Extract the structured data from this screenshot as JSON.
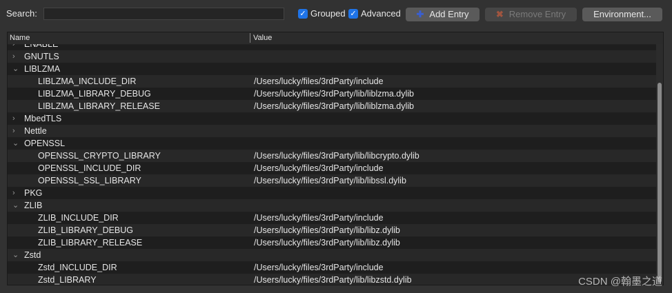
{
  "toolbar": {
    "search_label": "Search:",
    "search_value": "",
    "grouped": "Grouped",
    "advanced": "Advanced",
    "add": "Add Entry",
    "remove": "Remove Entry",
    "environment": "Environment..."
  },
  "table": {
    "headers": [
      "Name",
      "Value"
    ],
    "rows": [
      {
        "name": "ENABLE",
        "value": "",
        "group": true,
        "expanded": false
      },
      {
        "name": "GNUTLS",
        "value": "",
        "group": true,
        "expanded": false
      },
      {
        "name": "LIBLZMA",
        "value": "",
        "group": true,
        "expanded": true
      },
      {
        "name": "LIBLZMA_INCLUDE_DIR",
        "value": "/Users/lucky/files/3rdParty/include"
      },
      {
        "name": "LIBLZMA_LIBRARY_DEBUG",
        "value": "/Users/lucky/files/3rdParty/lib/liblzma.dylib"
      },
      {
        "name": "LIBLZMA_LIBRARY_RELEASE",
        "value": "/Users/lucky/files/3rdParty/lib/liblzma.dylib"
      },
      {
        "name": "MbedTLS",
        "value": "",
        "group": true,
        "expanded": false
      },
      {
        "name": "Nettle",
        "value": "",
        "group": true,
        "expanded": false
      },
      {
        "name": "OPENSSL",
        "value": "",
        "group": true,
        "expanded": true
      },
      {
        "name": "OPENSSL_CRYPTO_LIBRARY",
        "value": "/Users/lucky/files/3rdParty/lib/libcrypto.dylib"
      },
      {
        "name": "OPENSSL_INCLUDE_DIR",
        "value": "/Users/lucky/files/3rdParty/include"
      },
      {
        "name": "OPENSSL_SSL_LIBRARY",
        "value": "/Users/lucky/files/3rdParty/lib/libssl.dylib"
      },
      {
        "name": "PKG",
        "value": "",
        "group": true,
        "expanded": false
      },
      {
        "name": "ZLIB",
        "value": "",
        "group": true,
        "expanded": true
      },
      {
        "name": "ZLIB_INCLUDE_DIR",
        "value": "/Users/lucky/files/3rdParty/include"
      },
      {
        "name": "ZLIB_LIBRARY_DEBUG",
        "value": "/Users/lucky/files/3rdParty/lib/libz.dylib"
      },
      {
        "name": "ZLIB_LIBRARY_RELEASE",
        "value": "/Users/lucky/files/3rdParty/lib/libz.dylib"
      },
      {
        "name": "Zstd",
        "value": "",
        "group": true,
        "expanded": true
      },
      {
        "name": "Zstd_INCLUDE_DIR",
        "value": "/Users/lucky/files/3rdParty/include"
      },
      {
        "name": "Zstd_LIBRARY",
        "value": "/Users/lucky/files/3rdParty/lib/libzstd.dylib"
      }
    ]
  },
  "watermark": "CSDN @翰墨之道"
}
